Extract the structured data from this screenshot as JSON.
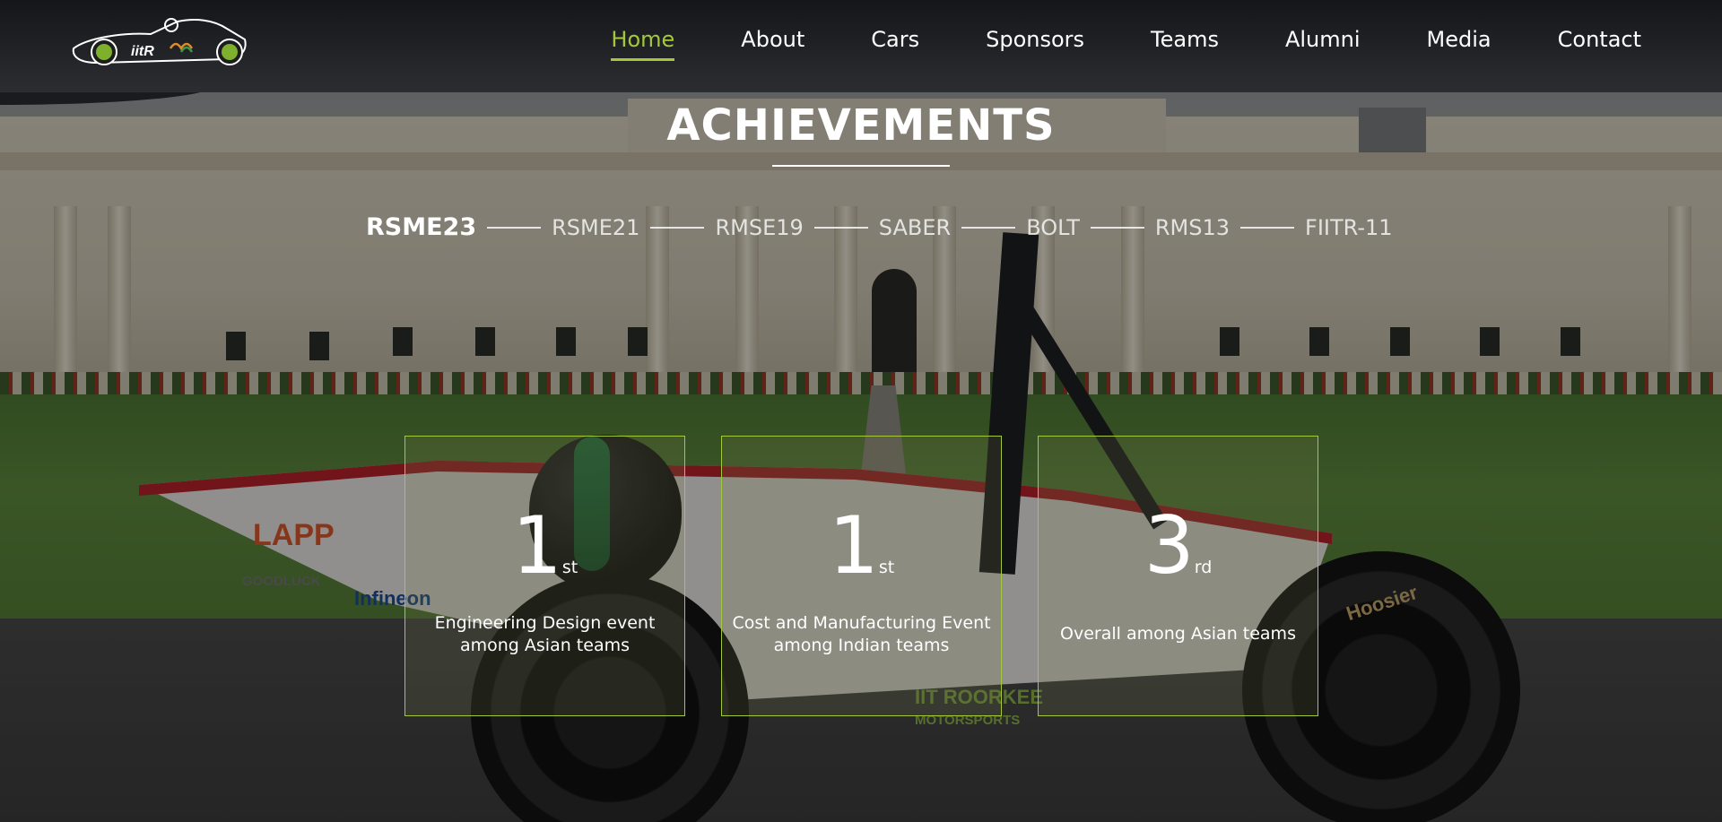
{
  "header": {
    "logo_alt": "IITR Motorsports logo",
    "nav": [
      {
        "label": "Home",
        "active": true
      },
      {
        "label": "About"
      },
      {
        "label": "Cars"
      },
      {
        "label": "Sponsors"
      },
      {
        "label": "Teams"
      },
      {
        "label": "Alumni"
      },
      {
        "label": "Media"
      },
      {
        "label": "Contact"
      }
    ]
  },
  "main": {
    "title": "ACHIEVEMENTS",
    "timeline": [
      "RSME23",
      "RSME21",
      "RMSE19",
      "SABER",
      "BOLT",
      "RMS13",
      "FIITR-11"
    ],
    "active_car": "RSME23",
    "cards": [
      {
        "rank": "1",
        "suffix": "st",
        "text": "Engineering Design event among Asian teams"
      },
      {
        "rank": "1",
        "suffix": "st",
        "text": "Cost and Manufacturing Event among Indian teams"
      },
      {
        "rank": "3",
        "suffix": "rd",
        "text": "Overall among Asian teams"
      }
    ]
  },
  "background": {
    "sponsors": [
      "LAPP",
      "GOODLUCK",
      "Infineon",
      "IIT ROORKEE",
      "MOTORSPORTS",
      "Hoosier"
    ]
  },
  "colors": {
    "accent": "#a3c93b",
    "header_bg": "#1b1c20",
    "text": "#ffffff"
  }
}
